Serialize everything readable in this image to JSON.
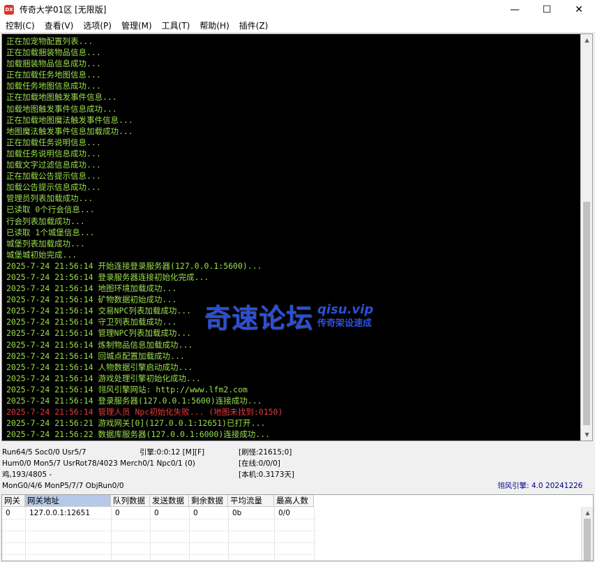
{
  "window": {
    "icon_text": "DX",
    "title": "传奇大学01区 [无限版]",
    "minimize": "—",
    "maximize": "☐",
    "close": "✕"
  },
  "menu": [
    "控制(C)",
    "查看(V)",
    "选项(P)",
    "管理(M)",
    "工具(T)",
    "帮助(H)",
    "插件(Z)"
  ],
  "log": [
    {
      "text": "正在加宠物配置列表...",
      "error": false
    },
    {
      "text": "正在加载捆装物品信息...",
      "error": false
    },
    {
      "text": "加载捆装物品信息成功...",
      "error": false
    },
    {
      "text": "正在加载任务地图信息...",
      "error": false
    },
    {
      "text": "加载任务地图信息成功...",
      "error": false
    },
    {
      "text": "正在加载地图触发事件信息...",
      "error": false
    },
    {
      "text": "加载地图触发事件信息成功...",
      "error": false
    },
    {
      "text": "正在加载地图魔法触发事件信息...",
      "error": false
    },
    {
      "text": "地图魔法触发事件信息加载成功...",
      "error": false
    },
    {
      "text": "正在加载任务说明信息...",
      "error": false
    },
    {
      "text": "加载任务说明信息成功...",
      "error": false
    },
    {
      "text": "加载文字过滤信息成功...",
      "error": false
    },
    {
      "text": "正在加载公告提示信息...",
      "error": false
    },
    {
      "text": "加载公告提示信息成功...",
      "error": false
    },
    {
      "text": "管理员列表加载成功...",
      "error": false
    },
    {
      "text": "已读取 0个行会信息...",
      "error": false
    },
    {
      "text": "行会列表加载成功...",
      "error": false
    },
    {
      "text": "已读取 1个城堡信息...",
      "error": false
    },
    {
      "text": "城堡列表加载成功...",
      "error": false
    },
    {
      "text": "城堡城初始完成...",
      "error": false
    },
    {
      "text": "2025-7-24 21:56:14 开始连接登录服务器(127.0.0.1:5600)...",
      "error": false
    },
    {
      "text": "2025-7-24 21:56:14 登录服务器连接初始化完成...",
      "error": false
    },
    {
      "text": "2025-7-24 21:56:14 地图环境加载成功...",
      "error": false
    },
    {
      "text": "2025-7-24 21:56:14 矿物数据初始成功...",
      "error": false
    },
    {
      "text": "2025-7-24 21:56:14 交易NPC列表加载成功...",
      "error": false
    },
    {
      "text": "2025-7-24 21:56:14 守卫列表加载成功...",
      "error": false
    },
    {
      "text": "2025-7-24 21:56:14 管理NPC列表加载成功...",
      "error": false
    },
    {
      "text": "2025-7-24 21:56:14 炼制物品信息加载成功...",
      "error": false
    },
    {
      "text": "2025-7-24 21:56:14 回城点配置加载成功...",
      "error": false
    },
    {
      "text": "2025-7-24 21:56:14 人物数据引擎启动成功...",
      "error": false
    },
    {
      "text": "2025-7-24 21:56:14 游戏处理引擎初始化成功...",
      "error": false
    },
    {
      "text": "2025-7-24 21:56:14 翎风引擎网站: http://www.lfm2.com",
      "error": false
    },
    {
      "text": "2025-7-24 21:56:14 登录服务器(127.0.0.1:5600)连接成功...",
      "error": false
    },
    {
      "text": "2025-7-24 21:56:14 管理人员 Npc初始化失败... (地图未找到:0150)",
      "error": true
    },
    {
      "text": "2025-7-24 21:56:21 游戏网关[0](127.0.0.1:12651)已打开...",
      "error": false
    },
    {
      "text": "2025-7-24 21:56:22 数据库服务器(127.0.0.1:6000)连接成功...",
      "error": false
    }
  ],
  "watermark": {
    "cn": "奇速论坛",
    "url": "qisu.vip",
    "sub": "传奇架设速成"
  },
  "status": {
    "line1_left": "Run64/5 Soc0/0 Usr5/7",
    "engine": "引擎:0:0:12 [M][F]",
    "refresh": "[刷怪:21615;0]",
    "line2_left": "Hum0/0 Mon5/7 UsrRot78/4023 Merch0/1 Npc0/1 (0)",
    "online": "[在线:0/0/0]",
    "line3_left": "鸡,193/4805 -",
    "local": "[本机:0.3173天]",
    "line4_left": "MonG0/4/6 MonP5/7/7 ObjRun0/0",
    "version": "翎风引擎: 4.0 20241226"
  },
  "gateway_table": {
    "headers": [
      "网关",
      "网关地址",
      "队列数据",
      "发送数据",
      "剩余数据",
      "平均流量",
      "最高人数"
    ],
    "rows": [
      [
        "0",
        "127.0.0.1:12651",
        "0",
        "0",
        "0",
        "0b",
        "0/0"
      ]
    ]
  }
}
